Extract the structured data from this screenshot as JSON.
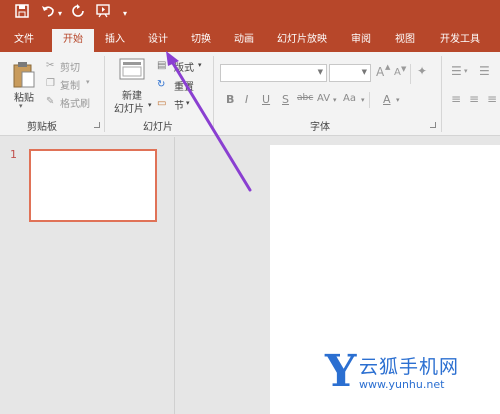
{
  "qat": {
    "save_icon": "save-icon",
    "undo_icon": "undo-icon",
    "redo_icon": "redo-icon",
    "present_icon": "start-from-beginning-icon",
    "customize_icon": "customize-qat-icon"
  },
  "tabs": [
    {
      "label": "文件"
    },
    {
      "label": "开始"
    },
    {
      "label": "插入"
    },
    {
      "label": "设计"
    },
    {
      "label": "切换"
    },
    {
      "label": "动画"
    },
    {
      "label": "幻灯片放映"
    },
    {
      "label": "审阅"
    },
    {
      "label": "视图"
    },
    {
      "label": "开发工具"
    }
  ],
  "active_tab": "开始",
  "clipboard": {
    "group_title": "剪贴板",
    "paste": "粘贴",
    "cut": "剪切",
    "copy": "复制",
    "format_painter": "格式刷"
  },
  "slides_group": {
    "group_title": "幻灯片",
    "new_slide_line1": "新建",
    "new_slide_line2": "幻灯片",
    "layout": "版式",
    "reset": "重置",
    "section": "节"
  },
  "font_group": {
    "group_title": "字体",
    "bold": "B",
    "italic": "I",
    "underline": "U",
    "shadow": "S",
    "strike": "abc",
    "spacing": "AV",
    "case": "Aa",
    "color": "A",
    "grow": "A",
    "shrink": "A"
  },
  "thumbnails": {
    "slide_number": "1"
  },
  "watermark": {
    "letter": "Y",
    "name": "云狐手机网",
    "url": "www.yunhu.net"
  },
  "colors": {
    "accent": "#b7472a",
    "thumb_border": "#e07257",
    "arrow": "#8a3fd1",
    "watermark": "#2b6fd1"
  }
}
